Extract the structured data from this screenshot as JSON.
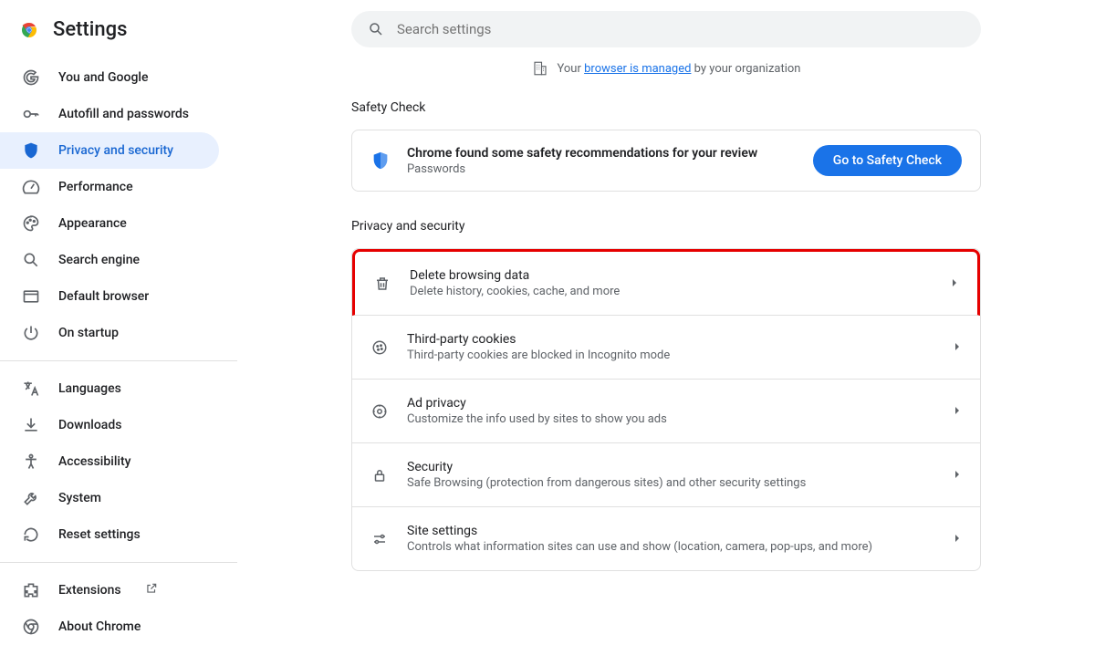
{
  "app_title": "Settings",
  "search": {
    "placeholder": "Search settings"
  },
  "managed": {
    "prefix": "Your ",
    "link": "browser is managed",
    "suffix": " by your organization"
  },
  "sidebar": {
    "items": [
      {
        "label": "You and Google"
      },
      {
        "label": "Autofill and passwords"
      },
      {
        "label": "Privacy and security"
      },
      {
        "label": "Performance"
      },
      {
        "label": "Appearance"
      },
      {
        "label": "Search engine"
      },
      {
        "label": "Default browser"
      },
      {
        "label": "On startup"
      }
    ],
    "items2": [
      {
        "label": "Languages"
      },
      {
        "label": "Downloads"
      },
      {
        "label": "Accessibility"
      },
      {
        "label": "System"
      },
      {
        "label": "Reset settings"
      }
    ],
    "items3": [
      {
        "label": "Extensions"
      },
      {
        "label": "About Chrome"
      }
    ]
  },
  "sections": {
    "safety_check": "Safety Check",
    "privacy_security": "Privacy and security"
  },
  "safety_card": {
    "title": "Chrome found some safety recommendations for your review",
    "sub": "Passwords",
    "button": "Go to Safety Check"
  },
  "rows": [
    {
      "title": "Delete browsing data",
      "sub": "Delete history, cookies, cache, and more"
    },
    {
      "title": "Third-party cookies",
      "sub": "Third-party cookies are blocked in Incognito mode"
    },
    {
      "title": "Ad privacy",
      "sub": "Customize the info used by sites to show you ads"
    },
    {
      "title": "Security",
      "sub": "Safe Browsing (protection from dangerous sites) and other security settings"
    },
    {
      "title": "Site settings",
      "sub": "Controls what information sites can use and show (location, camera, pop-ups, and more)"
    }
  ]
}
